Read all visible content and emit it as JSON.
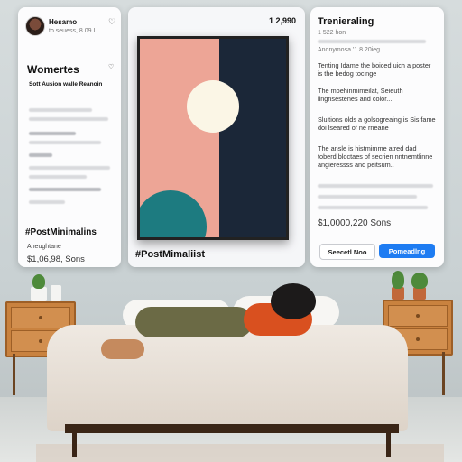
{
  "left_card": {
    "username": "Hesamo",
    "meta": "to seuess, 8.09 I",
    "section_title": "Womertes",
    "subtitle": "Sott Ausion walle Reanoin",
    "hashtag": "#PostMinimalins",
    "label": "Aneughtane",
    "price": "$1,06,98, Sons"
  },
  "center_card": {
    "count": "1 2,990",
    "hashtag": "#PostMimaliist"
  },
  "right_card": {
    "title": "Trenieraling",
    "meta": "1 522 hon",
    "subhead": "Anonymosa '1 8 20ieg",
    "para1": "Tenting Idame the boiced uich a poster is the bedog tocinge",
    "para2": "The moehinmimeilat, Seieuth iingnsestenes and color...",
    "para3": "Sluitions olds a golsogreaing is Sis fame doi lseared of ne rneane",
    "para4": "The ansle is histmimme atred dad toberd bloctaes of secrien nntnemtlinne angieressss and peitsum..",
    "price": "$1,0000,220 Sons",
    "btn_secondary": "Seecetl Noo",
    "btn_primary": "Pomeadlng"
  },
  "colors": {
    "primary_button": "#1e7cf2",
    "poster_pink": "#eda596",
    "poster_navy": "#1b2738",
    "poster_teal": "#1d7b80",
    "shirt_orange": "#d9501f"
  },
  "icons": {
    "like": "heart-icon"
  }
}
